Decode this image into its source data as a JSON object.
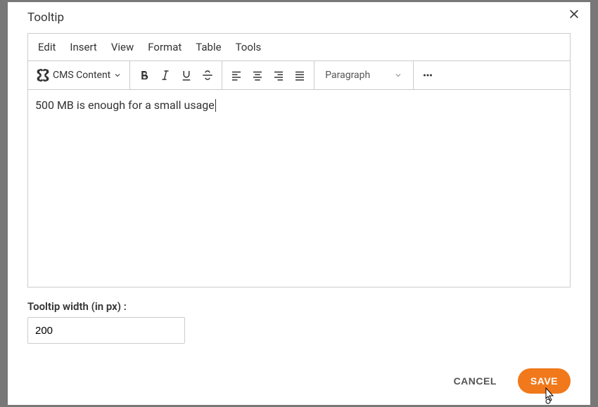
{
  "dialog": {
    "title": "Tooltip"
  },
  "menubar": {
    "edit": "Edit",
    "insert": "Insert",
    "view": "View",
    "format": "Format",
    "table": "Table",
    "tools": "Tools"
  },
  "toolbar": {
    "cms_label": "CMS Content",
    "format_select": "Paragraph",
    "icons": {
      "cms": "joomla-icon",
      "bold": "bold-icon",
      "italic": "italic-icon",
      "underline": "underline-icon",
      "strike": "strikethrough-icon",
      "align_left": "align-left-icon",
      "align_center": "align-center-icon",
      "align_right": "align-right-icon",
      "align_justify": "align-justify-icon",
      "more": "more-icon"
    }
  },
  "content": {
    "text": "500 MB is enough for a small usage"
  },
  "form": {
    "width_label": "Tooltip width (in px) :",
    "width_value": "200"
  },
  "buttons": {
    "cancel": "CANCEL",
    "save": "SAVE"
  }
}
